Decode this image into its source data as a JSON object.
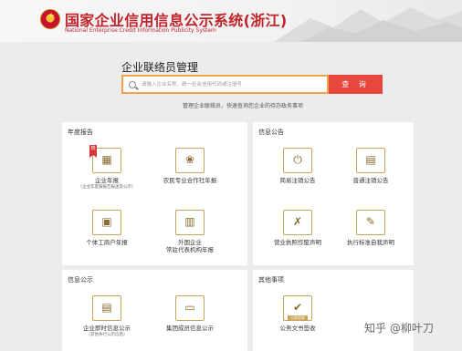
{
  "header": {
    "emblem_text": "★",
    "title": "国家企业信用信息公示系统(浙江)",
    "subtitle": "National Enterprise Credit Information Publicity System"
  },
  "search": {
    "title": "企业联络员管理",
    "placeholder": "请输入企业名称、统一社会信用代码或注册号",
    "button_label": "查 询",
    "hint": "管理企业联络员，快速查询您企业的待办政务事项"
  },
  "panels": {
    "annual": {
      "title": "年度报告",
      "items": [
        {
          "label": "企业年报",
          "sublabel": "(企业年度报报告报送及公示)",
          "icon": "calendar-icon",
          "glyph": "▦",
          "ribbon": "热"
        },
        {
          "label": "农民专业合作社年报",
          "icon": "coop-icon",
          "glyph": "❀"
        },
        {
          "label": "个体工商户年报",
          "icon": "briefcase-icon",
          "glyph": "▣"
        },
        {
          "label": "外国企业",
          "label2": "常驻代表机构年报",
          "icon": "building-icon",
          "glyph": "▥"
        }
      ]
    },
    "notice": {
      "title": "信息公告",
      "items": [
        {
          "label": "简易注销公告",
          "icon": "power-icon",
          "glyph": "⏻"
        },
        {
          "label": "普通注销公告",
          "icon": "document-icon",
          "glyph": "▤"
        },
        {
          "label": "营业执照作废声明",
          "icon": "void-license-icon",
          "glyph": "✗"
        },
        {
          "label": "执行标准自我声明",
          "icon": "standard-icon",
          "glyph": "✎"
        }
      ]
    },
    "disclosure": {
      "title": "信息公示",
      "items": [
        {
          "label": "企业即时信息公示",
          "sublabel": "(其他条行公示信息)",
          "icon": "instant-info-icon",
          "glyph": "▤"
        },
        {
          "label": "集团成员信息公示",
          "icon": "group-icon",
          "glyph": "▭"
        }
      ]
    },
    "other": {
      "title": "其他事项",
      "items": [
        {
          "label": "公务文书签收",
          "icon": "sign-icon",
          "glyph": "✔",
          "tag": "立即签收"
        }
      ]
    }
  },
  "watermark": "知乎 @柳叶刀",
  "colors": {
    "accent": "#c0242a",
    "search_border": "#f0a445",
    "search_button": "#e8473d",
    "icon_border": "#c9a35c",
    "ribbon": "#d8363b",
    "background": "#ececec"
  }
}
